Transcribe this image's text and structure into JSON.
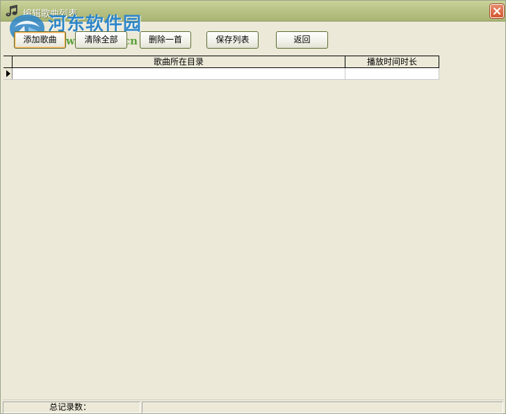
{
  "window": {
    "title": "编辑歌曲列表",
    "close_label": "✕"
  },
  "watermark": {
    "site_name": "河东软件园",
    "url": "www.pc0359.cn"
  },
  "toolbar": {
    "buttons": [
      {
        "label": "添加歌曲"
      },
      {
        "label": "清除全部"
      },
      {
        "label": "删除一首"
      },
      {
        "label": "保存列表"
      },
      {
        "label": "返回"
      }
    ]
  },
  "grid": {
    "columns": [
      "歌曲所在目录",
      "播放时间时长"
    ],
    "rows": [
      {
        "dir": "",
        "duration": ""
      }
    ]
  },
  "statusbar": {
    "record_label": "总记录数：",
    "record_value": ""
  },
  "colors": {
    "titlebar": "#B4BF80",
    "watermark_blue": "#2E86C8",
    "watermark_green": "#5AA23A",
    "close": "#D4572F"
  }
}
